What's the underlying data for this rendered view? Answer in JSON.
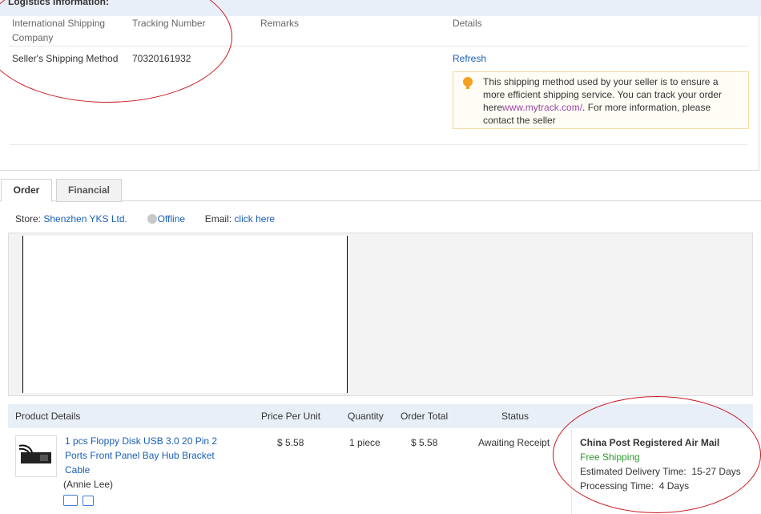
{
  "logistics": {
    "title": "Logistics Information:",
    "columns": {
      "company": "International Shipping Company",
      "tracking": "Tracking Number",
      "remarks": "Remarks",
      "details": "Details"
    },
    "row": {
      "company": "Seller's Shipping Method",
      "tracking": "70320161932",
      "remarks": "",
      "refresh": "Refresh"
    },
    "tip": {
      "text_before": "This shipping method used by your seller is to ensure a more efficient shipping service. You can track your order here",
      "link": "www.mytrack.com/",
      "text_after": ". For more information, please contact the seller"
    }
  },
  "tabs": [
    {
      "label": "Order",
      "active": true
    },
    {
      "label": "Financial",
      "active": false
    }
  ],
  "store": {
    "store_label": "Store:",
    "store_name": "Shenzhen YKS Ltd.",
    "status": "Offline",
    "email_label": "Email:",
    "email_link": "click here"
  },
  "table": {
    "headers": {
      "product": "Product Details",
      "price": "Price Per Unit",
      "quantity": "Quantity",
      "total": "Order Total",
      "status": "Status"
    },
    "item": {
      "name": "1 pcs Floppy Disk USB 3.0 20 Pin 2 Ports Front Panel Bay Hub Bracket Cable",
      "buyer": "(Annie Lee)",
      "price": "$ 5.58",
      "quantity": "1 piece",
      "total": "$ 5.58",
      "status": "Awaiting Receipt"
    },
    "shipping": {
      "method": "China Post Registered Air Mail",
      "free": "Free Shipping",
      "delivery_label": "Estimated Delivery Time:",
      "delivery_value": "15-27 Days",
      "processing_label": "Processing Time:",
      "processing_value": "4 Days"
    }
  },
  "colors": {
    "link": "#1a5fb4",
    "free_shipping": "#2e9a2e",
    "annotation": "#c8191e"
  }
}
